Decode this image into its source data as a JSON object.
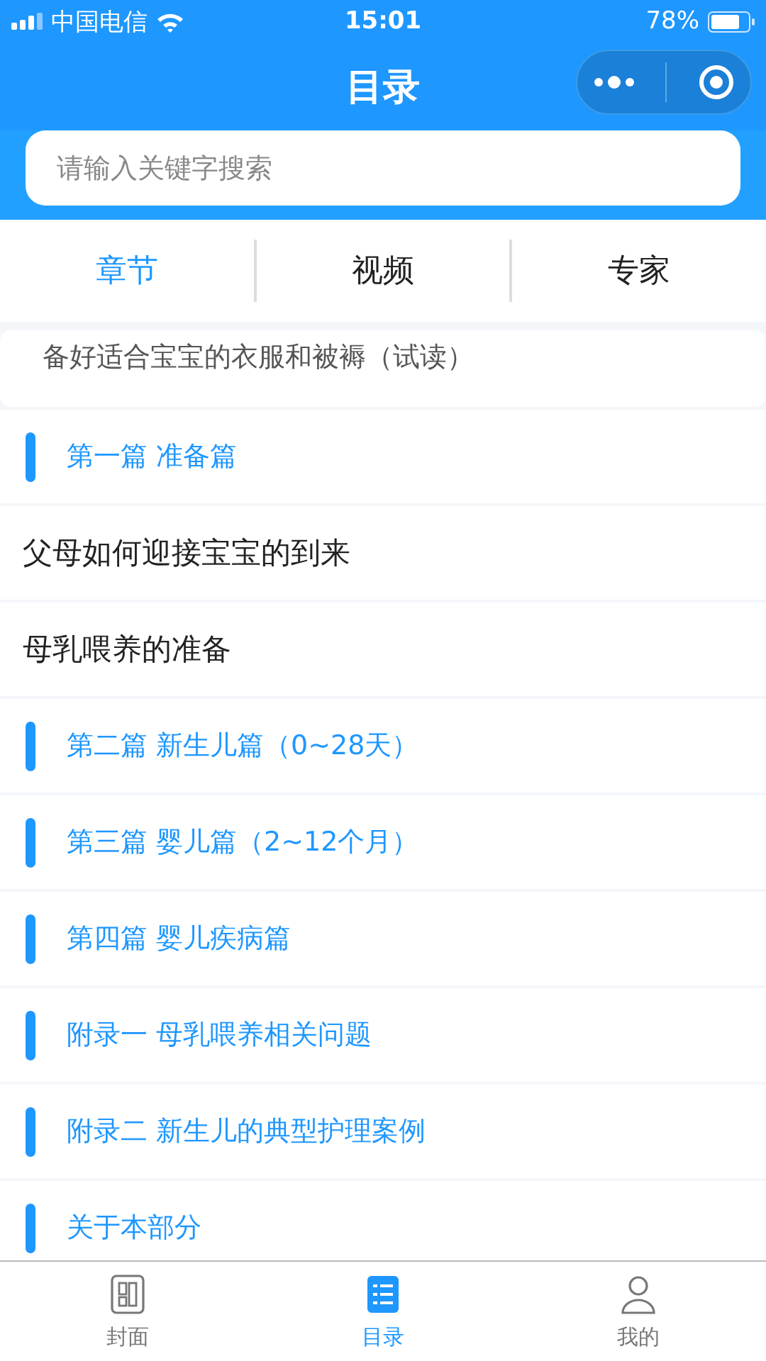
{
  "status_bar": {
    "carrier": "中国电信",
    "time": "15:01",
    "battery": "78%"
  },
  "nav": {
    "title": "目录"
  },
  "search": {
    "placeholder": "请输入关键字搜索"
  },
  "tabs": [
    {
      "label": "章节",
      "selected": true
    },
    {
      "label": "视频",
      "selected": false
    },
    {
      "label": "专家",
      "selected": false
    }
  ],
  "list": [
    {
      "kind": "lesson",
      "text": "备好适合宝宝的衣服和被褥（试读）"
    },
    {
      "kind": "part",
      "text": "第一篇 准备篇"
    },
    {
      "kind": "chapter",
      "text": "父母如何迎接宝宝的到来"
    },
    {
      "kind": "chapter",
      "text": "母乳喂养的准备"
    },
    {
      "kind": "part",
      "text": "第二篇 新生儿篇（0~28天）"
    },
    {
      "kind": "part",
      "text": "第三篇 婴儿篇（2~12个月）"
    },
    {
      "kind": "part",
      "text": "第四篇 婴儿疾病篇"
    },
    {
      "kind": "part",
      "text": "附录一 母乳喂养相关问题"
    },
    {
      "kind": "part",
      "text": "附录二 新生儿的典型护理案例"
    },
    {
      "kind": "part",
      "text": "关于本部分"
    }
  ],
  "tab_bar": [
    {
      "label": "封面",
      "kind": "cover",
      "selected": false
    },
    {
      "label": "目录",
      "kind": "list",
      "selected": true
    },
    {
      "label": "我的",
      "kind": "user",
      "selected": false
    }
  ]
}
